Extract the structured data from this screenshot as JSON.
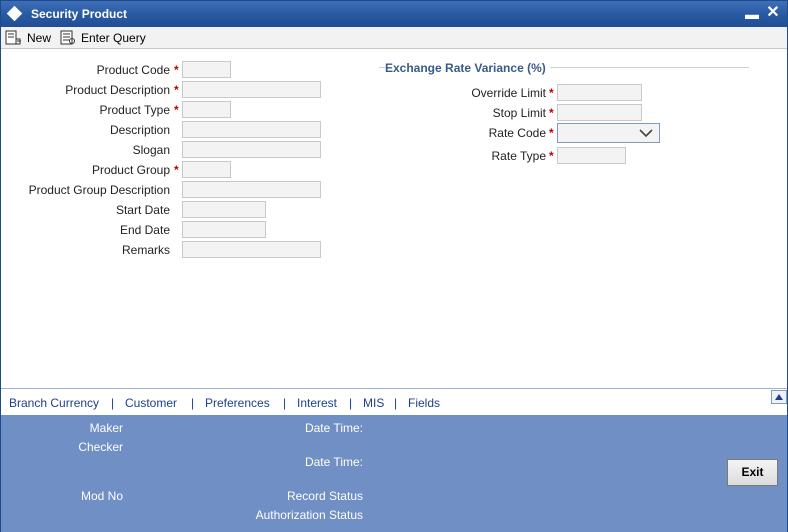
{
  "window": {
    "title": "Security Product"
  },
  "toolbar": {
    "new_label": "New",
    "enter_query_label": "Enter Query"
  },
  "form": {
    "product_code": {
      "label": "Product Code",
      "value": ""
    },
    "product_description": {
      "label": "Product Description",
      "value": ""
    },
    "product_type": {
      "label": "Product Type",
      "value": ""
    },
    "description": {
      "label": "Description",
      "value": ""
    },
    "slogan": {
      "label": "Slogan",
      "value": ""
    },
    "product_group": {
      "label": "Product Group",
      "value": ""
    },
    "product_group_description": {
      "label": "Product Group Description",
      "value": ""
    },
    "start_date": {
      "label": "Start Date",
      "value": ""
    },
    "end_date": {
      "label": "End Date",
      "value": ""
    },
    "remarks": {
      "label": "Remarks",
      "value": ""
    },
    "required_marker": "*"
  },
  "exchange_rate": {
    "title": "Exchange Rate Variance (%)",
    "override_limit": {
      "label": "Override Limit",
      "value": ""
    },
    "stop_limit": {
      "label": "Stop Limit",
      "value": ""
    },
    "rate_code": {
      "label": "Rate Code",
      "selected": ""
    },
    "rate_type": {
      "label": "Rate Type",
      "value": ""
    }
  },
  "tabs": [
    "Branch Currency",
    "Customer",
    "Preferences",
    "Interest",
    "MIS",
    "Fields"
  ],
  "tab_separator": "|",
  "footer": {
    "maker": "Maker",
    "checker": "Checker",
    "date_time_1": "Date Time:",
    "date_time_2": "Date Time:",
    "mod_no": "Mod No",
    "record_status": "Record Status",
    "authorization_status": "Authorization Status",
    "exit_label": "Exit"
  },
  "colors": {
    "titlebar": "#2a5aa3",
    "footer": "#6f8fc5",
    "required": "#c00000",
    "link": "#1f3f8a"
  }
}
